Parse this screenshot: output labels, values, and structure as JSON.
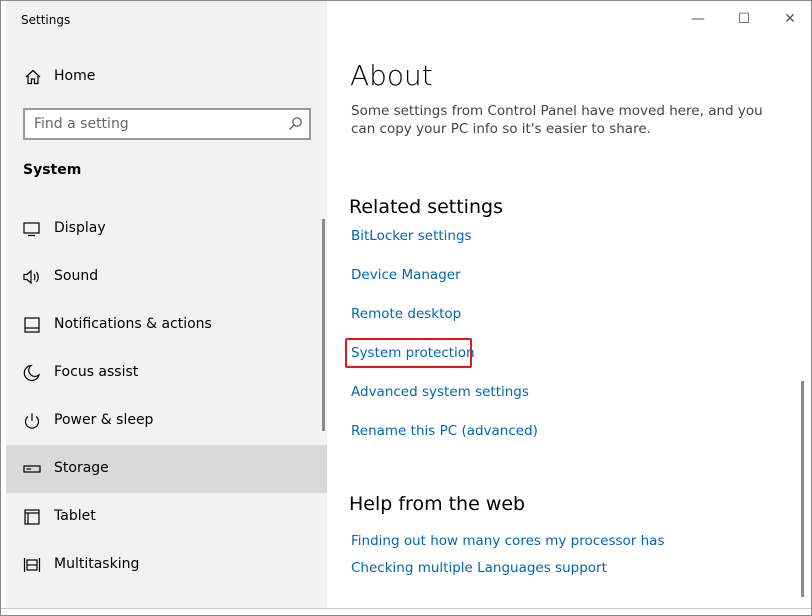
{
  "window": {
    "title": "Settings",
    "controls": {
      "minimize": "—",
      "maximize": "☐",
      "close": "✕"
    }
  },
  "sidebar": {
    "home_label": "Home",
    "search": {
      "placeholder": "Find a setting",
      "value": ""
    },
    "section_title": "System",
    "items": [
      {
        "label": "Display",
        "icon": "monitor-icon"
      },
      {
        "label": "Sound",
        "icon": "speaker-icon"
      },
      {
        "label": "Notifications & actions",
        "icon": "notifications-icon"
      },
      {
        "label": "Focus assist",
        "icon": "moon-icon"
      },
      {
        "label": "Power & sleep",
        "icon": "power-icon"
      },
      {
        "label": "Storage",
        "icon": "storage-icon",
        "selected": true
      },
      {
        "label": "Tablet",
        "icon": "tablet-icon"
      },
      {
        "label": "Multitasking",
        "icon": "multitasking-icon"
      }
    ]
  },
  "main": {
    "title": "About",
    "description": "Some settings from Control Panel have moved here, and you can copy your PC info so it's easier to share.",
    "related": {
      "heading": "Related settings",
      "links": [
        "BitLocker settings",
        "Device Manager",
        "Remote desktop",
        "System protection",
        "Advanced system settings",
        "Rename this PC (advanced)"
      ],
      "highlighted_link": "System protection"
    },
    "help": {
      "heading": "Help from the web",
      "links": [
        "Finding out how many cores my processor has",
        "Checking multiple Languages support"
      ]
    }
  },
  "colors": {
    "link": "#0066b4",
    "sidebar_bg": "#f2f2f2",
    "selected_bg": "#d9d9d9",
    "highlight_border": "#e8141b"
  }
}
